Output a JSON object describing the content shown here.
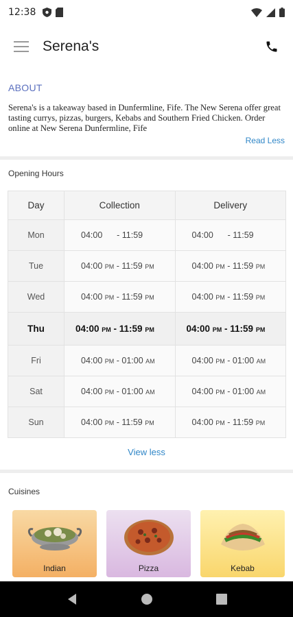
{
  "status_bar": {
    "time": "12:38"
  },
  "app_bar": {
    "title": "Serena's"
  },
  "about": {
    "heading": "ABOUT",
    "text": "Serena's is a takeaway based in Dunfermline, Fife. The New Serena offer great tasting currys, pizzas, burgers, Kebabs and Southern Fried Chicken. Order online at New Serena Dunfermline, Fife",
    "read_less_label": "Read Less"
  },
  "opening_hours": {
    "title": "Opening Hours",
    "headers": {
      "day": "Day",
      "collection": "Collection",
      "delivery": "Delivery"
    },
    "rows": [
      {
        "day": "Mon",
        "collection": "04:00      - 11:59",
        "delivery": "04:00      - 11:59",
        "today": false
      },
      {
        "day": "Tue",
        "collection": "04:00 PM - 11:59 PM",
        "delivery": "04:00 PM - 11:59 PM",
        "today": false
      },
      {
        "day": "Wed",
        "collection": "04:00 PM - 11:59 PM",
        "delivery": "04:00 PM - 11:59 PM",
        "today": false
      },
      {
        "day": "Thu",
        "collection": "04:00 PM - 11:59 PM",
        "delivery": "04:00 PM - 11:59 PM",
        "today": true
      },
      {
        "day": "Fri",
        "collection": "04:00 PM - 01:00 AM",
        "delivery": "04:00 PM - 01:00 AM",
        "today": false
      },
      {
        "day": "Sat",
        "collection": "04:00 PM - 01:00 AM",
        "delivery": "04:00 PM - 01:00 AM",
        "today": false
      },
      {
        "day": "Sun",
        "collection": "04:00 PM - 11:59 PM",
        "delivery": "04:00 PM - 11:59 PM",
        "today": false
      }
    ],
    "view_less_label": "View less"
  },
  "cuisines": {
    "title": "Cuisines",
    "items": [
      {
        "label": "Indian",
        "icon": "curry-bowl-icon"
      },
      {
        "label": "Pizza",
        "icon": "pizza-icon"
      },
      {
        "label": "Kebab",
        "icon": "kebab-wrap-icon"
      }
    ]
  },
  "colors": {
    "accent_blue": "#2f86c7",
    "heading_blue": "#5a6fbe"
  }
}
